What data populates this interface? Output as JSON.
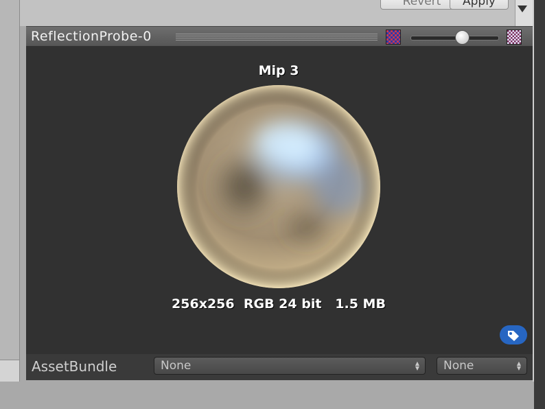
{
  "inspector": {
    "revert_label": "Revert",
    "apply_label": "Apply"
  },
  "preview": {
    "title": "ReflectionProbe-0",
    "mip_label": "Mip 3",
    "info": "256x256  RGB 24 bit   1.5 MB",
    "mip_slider_fraction": 0.6
  },
  "asset_bundle": {
    "label": "AssetBundle",
    "name_value": "None",
    "variant_value": "None"
  },
  "colors": {
    "preview_bg": "#313131",
    "tag_blue": "#2766c2"
  },
  "icons": {
    "tag": "tag-icon",
    "checker_small": "checker-small-icon",
    "checker_large": "checker-large-icon"
  }
}
